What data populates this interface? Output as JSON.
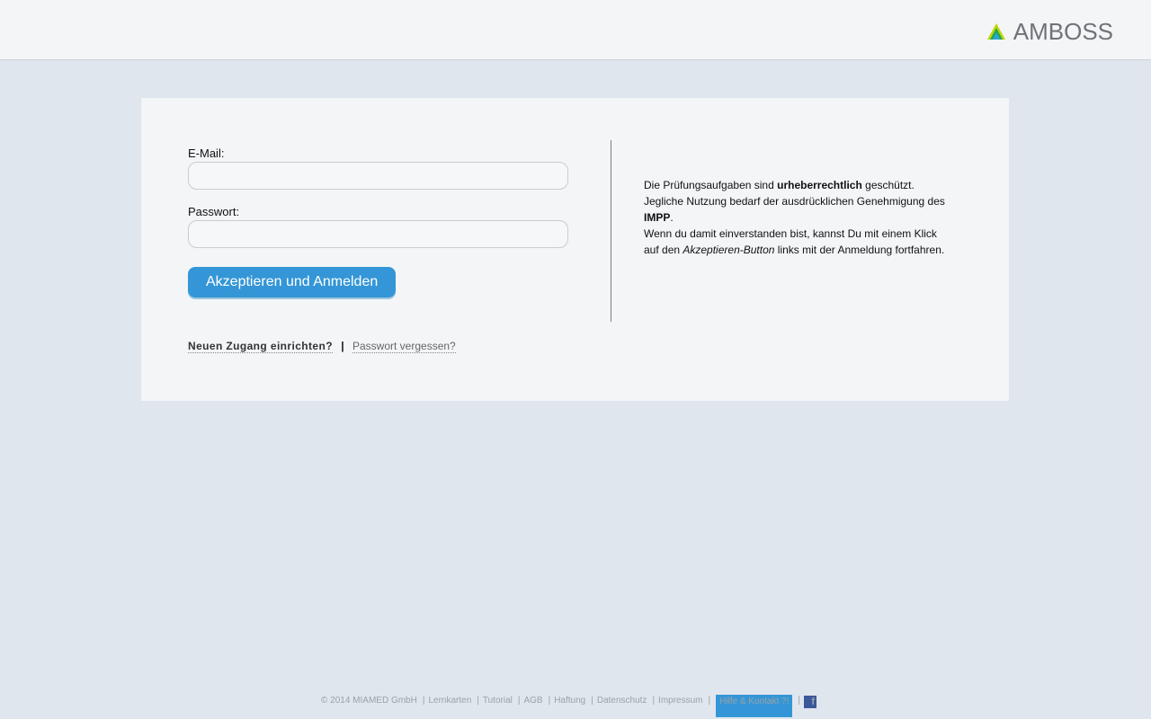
{
  "header": {
    "brand": "AMBOSS"
  },
  "login": {
    "email_label": "E-Mail:",
    "email_value": "",
    "password_label": "Passwort:",
    "password_value": "",
    "submit_label": "Akzeptieren und Anmelden",
    "new_account_link": "Neuen Zugang einrichten?",
    "separator": "|",
    "forgot_password_link": "Passwort vergessen?"
  },
  "notice": {
    "p1_before": "Die Prüfungsaufgaben sind ",
    "p1_bold": "urheberrechtlich",
    "p1_after": " geschützt. Jegliche Nutzung bedarf der ausdrücklichen Genehmigung des ",
    "p1_bold2": "IMPP",
    "p1_end": ".",
    "p2_before": "Wenn du damit einverstanden bist, kannst Du mit einem Klick auf den ",
    "p2_italic": "Akzeptieren-Button",
    "p2_after": " links mit der Anmeldung fortfahren."
  },
  "footer": {
    "copyright": "© 2014 MIAMED GmbH",
    "links": [
      "Lernkarten",
      "Tutorial",
      "AGB",
      "Haftung",
      "Datenschutz",
      "Impressum"
    ],
    "help_button": "Hilfe & Kontakt ?!",
    "facebook_glyph": "f"
  },
  "colors": {
    "accent": "#3496d6",
    "page_bg": "#e0e6ee",
    "card_bg": "#f3f5f7"
  },
  "icons": {
    "logo": "amboss-triangle-logo-icon",
    "social": "facebook-icon"
  }
}
